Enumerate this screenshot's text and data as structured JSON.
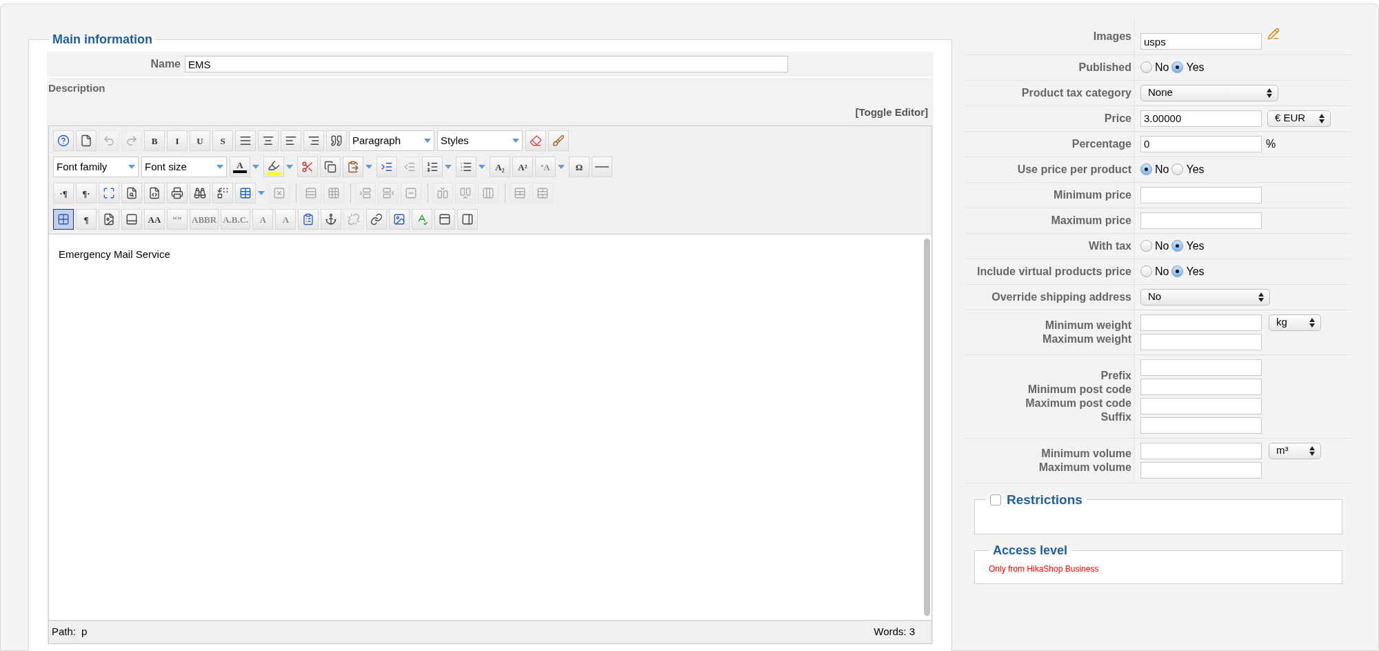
{
  "main_information": {
    "legend": "Main information",
    "name_label": "Name",
    "name_value": "EMS",
    "description_label": "Description",
    "toggle_editor": "[Toggle Editor]"
  },
  "editor": {
    "toolbar": [
      {
        "items": [
          {
            "kind": "button",
            "disabled": false,
            "active": false
          },
          {
            "kind": "button",
            "disabled": false,
            "active": false
          },
          {
            "kind": "button",
            "disabled": true,
            "active": false
          },
          {
            "kind": "button",
            "disabled": true,
            "active": false
          },
          {
            "kind": "glyph",
            "glyph": "B",
            "disabled": false,
            "active": false
          },
          {
            "kind": "glyph",
            "glyph": "I",
            "disabled": false,
            "active": false
          },
          {
            "kind": "glyph",
            "glyph": "U",
            "disabled": false,
            "active": false
          },
          {
            "kind": "glyph",
            "glyph": "S",
            "disabled": false,
            "active": false
          },
          {
            "kind": "button",
            "disabled": false,
            "active": false
          },
          {
            "kind": "button",
            "disabled": false,
            "active": false
          },
          {
            "kind": "button",
            "disabled": false,
            "active": false
          },
          {
            "kind": "button",
            "disabled": false,
            "active": false
          },
          {
            "kind": "button",
            "disabled": false,
            "active": false
          },
          {
            "kind": "select",
            "value": "Paragraph"
          },
          {
            "kind": "select",
            "value": "Styles"
          },
          {
            "kind": "button",
            "disabled": false,
            "active": false
          },
          {
            "kind": "button",
            "disabled": false,
            "active": false
          }
        ]
      },
      {
        "items": [
          {
            "kind": "select",
            "value": "Font family"
          },
          {
            "kind": "select",
            "value": "Font size"
          },
          {
            "kind": "split_glyph",
            "glyph": "A",
            "color": "#000000",
            "disabled": false,
            "active": false
          },
          {
            "kind": "split",
            "color": "#ffff00",
            "disabled": false,
            "active": false
          },
          {
            "kind": "button",
            "disabled": false,
            "active": false
          },
          {
            "kind": "button",
            "disabled": false,
            "active": false
          },
          {
            "kind": "split",
            "disabled": false,
            "active": false
          },
          {
            "kind": "button",
            "disabled": false,
            "active": false
          },
          {
            "kind": "button",
            "disabled": true,
            "active": false
          },
          {
            "kind": "split",
            "disabled": false,
            "active": false
          },
          {
            "kind": "split",
            "disabled": false,
            "active": false
          },
          {
            "kind": "glyph",
            "glyph": "A₂",
            "disabled": false,
            "active": false
          },
          {
            "kind": "glyph",
            "glyph": "A²",
            "disabled": false,
            "active": false
          },
          {
            "kind": "split_glyph",
            "glyph": "ªA",
            "disabled": true,
            "active": false
          },
          {
            "kind": "glyph",
            "glyph": "Ω",
            "disabled": false,
            "active": false
          },
          {
            "kind": "button",
            "disabled": false,
            "active": false
          }
        ]
      },
      {
        "items": [
          {
            "kind": "glyph",
            "glyph": "·¶",
            "disabled": false,
            "active": false
          },
          {
            "kind": "glyph",
            "glyph": "¶·",
            "disabled": false,
            "active": false
          },
          {
            "kind": "button",
            "disabled": false,
            "active": false
          },
          {
            "kind": "button",
            "disabled": false,
            "active": false
          },
          {
            "kind": "button",
            "disabled": false,
            "active": false
          },
          {
            "kind": "button",
            "disabled": false,
            "active": false
          },
          {
            "kind": "button",
            "disabled": false,
            "active": false
          },
          {
            "kind": "button",
            "disabled": false,
            "active": false
          },
          {
            "kind": "split",
            "disabled": false,
            "active": false
          },
          {
            "kind": "button",
            "disabled": true,
            "active": false
          },
          {
            "kind": "separator"
          },
          {
            "kind": "button",
            "disabled": true,
            "active": false
          },
          {
            "kind": "button",
            "disabled": true,
            "active": false
          },
          {
            "kind": "separator"
          },
          {
            "kind": "button",
            "disabled": true,
            "active": false
          },
          {
            "kind": "button",
            "disabled": true,
            "active": false
          },
          {
            "kind": "button",
            "disabled": true,
            "active": false
          },
          {
            "kind": "separator"
          },
          {
            "kind": "button",
            "disabled": true,
            "active": false
          },
          {
            "kind": "button",
            "disabled": true,
            "active": false
          },
          {
            "kind": "button",
            "disabled": true,
            "active": false
          },
          {
            "kind": "separator"
          },
          {
            "kind": "button",
            "disabled": true,
            "active": false
          },
          {
            "kind": "button",
            "disabled": true,
            "active": false
          }
        ]
      },
      {
        "items": [
          {
            "kind": "button",
            "disabled": false,
            "active": true
          },
          {
            "kind": "glyph",
            "glyph": "¶",
            "disabled": false,
            "active": false
          },
          {
            "kind": "button",
            "disabled": false,
            "active": false
          },
          {
            "kind": "button",
            "disabled": false,
            "active": false
          },
          {
            "kind": "glyph",
            "glyph": "AA",
            "disabled": false,
            "active": false
          },
          {
            "kind": "glyph",
            "glyph": "“”",
            "disabled": true,
            "active": false
          },
          {
            "kind": "glyph",
            "glyph": "ABBR",
            "disabled": true,
            "active": false
          },
          {
            "kind": "glyph",
            "glyph": "A.B.C.",
            "disabled": true,
            "active": false
          },
          {
            "kind": "glyph",
            "glyph": "A",
            "disabled": true,
            "active": false
          },
          {
            "kind": "glyph",
            "glyph": "A",
            "disabled": true,
            "active": false
          },
          {
            "kind": "button",
            "disabled": false,
            "active": false
          },
          {
            "kind": "button",
            "disabled": false,
            "active": false
          },
          {
            "kind": "button",
            "disabled": true,
            "active": false
          },
          {
            "kind": "button",
            "disabled": false,
            "active": false
          },
          {
            "kind": "button",
            "disabled": false,
            "active": false
          },
          {
            "kind": "button",
            "disabled": false,
            "active": false
          },
          {
            "kind": "button",
            "disabled": false,
            "active": false
          },
          {
            "kind": "button",
            "disabled": false,
            "active": false
          }
        ]
      }
    ],
    "content": "Emergency Mail Service",
    "path_label": "Path:",
    "path_value": "p",
    "words": "Words: 3"
  },
  "fields": [
    {
      "kind": "image",
      "label": "Images",
      "value": "usps"
    },
    {
      "kind": "radio",
      "label": "Published",
      "options": [
        {
          "label": "No",
          "selected": false
        },
        {
          "label": "Yes",
          "selected": true
        }
      ]
    },
    {
      "kind": "select",
      "label": "Product tax category",
      "value": "None"
    },
    {
      "kind": "input_select",
      "label": "Price",
      "value": "3.00000",
      "unit": "€ EUR"
    },
    {
      "kind": "input_suffix",
      "label": "Percentage",
      "value": "0",
      "suffix": "%"
    },
    {
      "kind": "radio",
      "label": "Use price per product",
      "options": [
        {
          "label": "No",
          "selected": true
        },
        {
          "label": "Yes",
          "selected": false
        }
      ]
    },
    {
      "kind": "input",
      "label": "Minimum price"
    },
    {
      "kind": "input",
      "label": "Maximum price"
    },
    {
      "kind": "radio",
      "label": "With tax",
      "options": [
        {
          "label": "No",
          "selected": false
        },
        {
          "label": "Yes",
          "selected": true
        }
      ]
    },
    {
      "kind": "radio",
      "label": "Include virtual products price",
      "options": [
        {
          "label": "No",
          "selected": false
        },
        {
          "label": "Yes",
          "selected": true
        }
      ]
    },
    {
      "kind": "select_small",
      "label": "Override shipping address",
      "value": "No"
    },
    {
      "kind": "group",
      "items": [
        {
          "label": "Minimum weight"
        },
        {
          "label": "Maximum weight"
        }
      ],
      "unit": "kg"
    },
    {
      "kind": "group",
      "items": [
        {
          "label": "Prefix"
        },
        {
          "label": "Minimum post code"
        },
        {
          "label": "Maximum post code"
        },
        {
          "label": "Suffix"
        }
      ]
    },
    {
      "kind": "group",
      "items": [
        {
          "label": "Minimum volume"
        },
        {
          "label": "Maximum volume"
        }
      ],
      "unit": "m³"
    }
  ],
  "restrictions": {
    "legend": "Restrictions",
    "checked": false
  },
  "access_level": {
    "legend": "Access level",
    "note": "Only from HikaShop Business"
  }
}
